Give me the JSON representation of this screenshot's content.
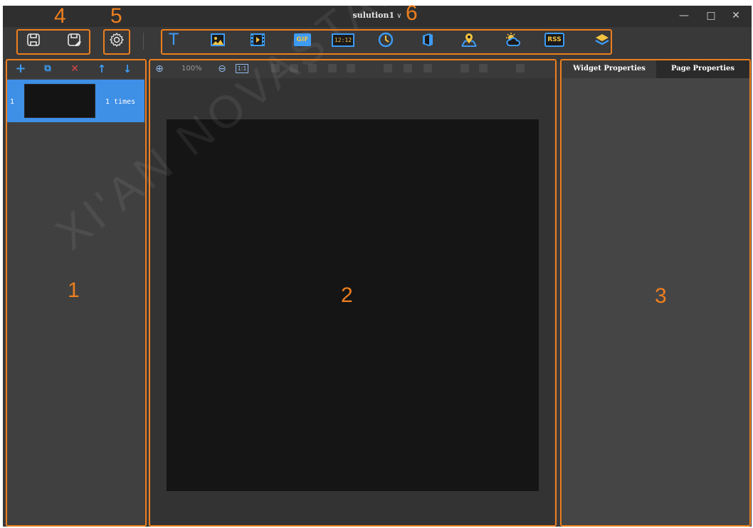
{
  "window": {
    "title": "sulution1",
    "title_chevron": "∨",
    "minimize": "—",
    "maximize": "□",
    "close": "✕"
  },
  "toolbar": {
    "save_icon": "save-icon",
    "save_as_icon": "save-as-icon",
    "settings_icon": "settings-icon",
    "media": [
      {
        "name": "text-icon",
        "label": "T"
      },
      {
        "name": "image-icon",
        "label": ""
      },
      {
        "name": "video-icon",
        "label": ""
      },
      {
        "name": "gif-icon",
        "label": "GIF"
      },
      {
        "name": "digital-clock-icon",
        "label": "12:12"
      },
      {
        "name": "analog-clock-icon",
        "label": ""
      },
      {
        "name": "office-icon",
        "label": ""
      },
      {
        "name": "location-icon",
        "label": ""
      },
      {
        "name": "weather-icon",
        "label": ""
      },
      {
        "name": "rss-icon",
        "label": "RSS"
      },
      {
        "name": "layers-icon",
        "label": ""
      }
    ]
  },
  "pages": {
    "tools": [
      {
        "name": "add-page-icon",
        "glyph": "+"
      },
      {
        "name": "copy-page-icon",
        "glyph": "⧉"
      },
      {
        "name": "delete-page-icon",
        "glyph": "✕"
      },
      {
        "name": "move-up-icon",
        "glyph": "↑"
      },
      {
        "name": "move-down-icon",
        "glyph": "↓"
      }
    ],
    "items": [
      {
        "number": "1",
        "times": "1 times"
      }
    ]
  },
  "editor": {
    "zoom_in": "⊕",
    "zoom_level": "100%",
    "zoom_out": "⊖",
    "actual_size": "1:1"
  },
  "properties": {
    "tabs": [
      "Widget Properties",
      "Page Properties"
    ],
    "active_tab": 1
  },
  "annotations": [
    "1",
    "2",
    "3",
    "4",
    "5",
    "6"
  ],
  "watermark": "XI'AN NOVASTAR",
  "colors": {
    "accent": "#3e8fe6",
    "highlight": "#ee7f1e",
    "icon_blue": "#3d9bf3",
    "delete_red": "#e04646",
    "media_yellow": "#f5c342"
  }
}
